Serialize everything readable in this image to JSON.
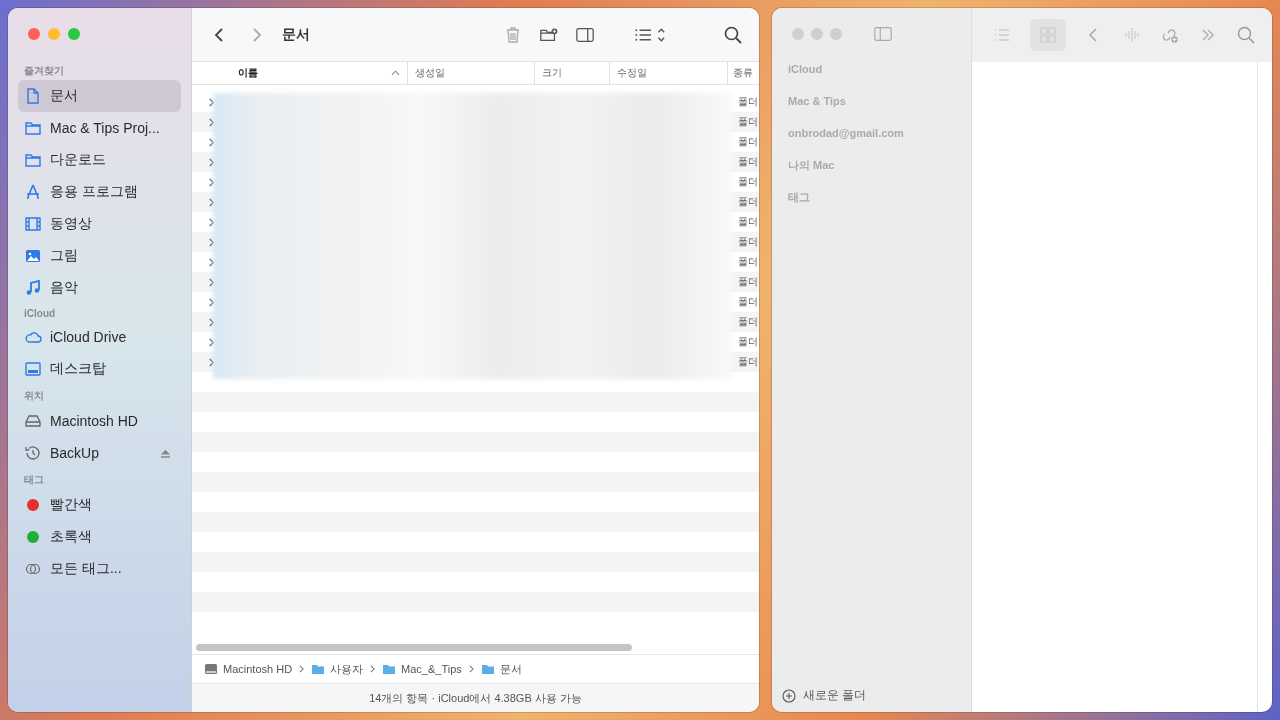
{
  "finder": {
    "title": "문서",
    "sidebar": [
      {
        "heading": "즐겨찾기",
        "items": [
          {
            "label": "문서",
            "selected": true
          },
          {
            "label": "Mac & Tips Proj...",
            "selected": false
          },
          {
            "label": "다운로드",
            "selected": false
          },
          {
            "label": "응용 프로그램",
            "selected": false
          },
          {
            "label": "동영상",
            "selected": false
          },
          {
            "label": "그림",
            "selected": false
          },
          {
            "label": "음악",
            "selected": false
          }
        ]
      },
      {
        "heading": "iCloud",
        "items": [
          {
            "label": "iCloud Drive",
            "selected": false
          },
          {
            "label": "데스크탑",
            "selected": false
          }
        ]
      },
      {
        "heading": "위치",
        "items": [
          {
            "label": "Macintosh HD",
            "selected": false,
            "ejectable": false
          },
          {
            "label": "BackUp",
            "selected": false,
            "ejectable": true
          }
        ]
      },
      {
        "heading": "태그",
        "items": [
          {
            "label": "빨간색",
            "color": "#e5302f",
            "selected": false
          },
          {
            "label": "초록색",
            "color": "#1fae3a",
            "selected": false
          },
          {
            "label": "모든 태그...",
            "selected": false
          }
        ]
      }
    ],
    "columns": [
      {
        "label": "이름",
        "sorted": true
      },
      {
        "label": "생성일",
        "sorted": false
      },
      {
        "label": "크기",
        "sorted": false
      },
      {
        "label": "수정일",
        "sorted": false
      },
      {
        "label": "종류",
        "sorted": false
      }
    ],
    "rows": [
      {
        "type_label": "폴더"
      },
      {
        "type_label": "폴더"
      },
      {
        "type_label": "폴더"
      },
      {
        "type_label": "폴더"
      },
      {
        "type_label": "폴더"
      },
      {
        "type_label": "폴더"
      },
      {
        "type_label": "폴더"
      },
      {
        "type_label": "폴더"
      },
      {
        "type_label": "폴더"
      },
      {
        "type_label": "폴더"
      },
      {
        "type_label": "폴더"
      },
      {
        "type_label": "폴더"
      },
      {
        "type_label": "폴더"
      },
      {
        "type_label": "폴더"
      }
    ],
    "path_bar": [
      "Macintosh HD",
      "사용자",
      "Mac_&_Tips",
      "문서"
    ],
    "status_bar": "14개의 항목 · iCloud에서 4.38GB 사용 가능"
  },
  "notes": {
    "sidebar": [
      "iCloud",
      "Mac & Tips",
      "onbrodad@gmail.com",
      "나의 Mac",
      "태그"
    ],
    "new_folder": "새로운 폴더"
  }
}
